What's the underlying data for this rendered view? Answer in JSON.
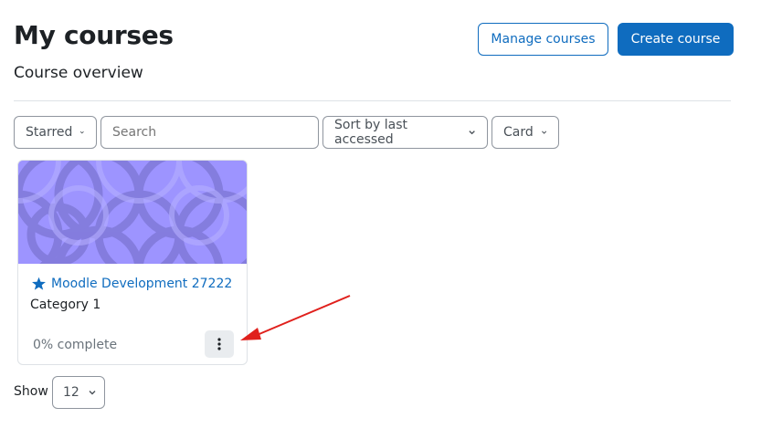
{
  "page": {
    "title": "My courses"
  },
  "header_actions": {
    "manage_courses": "Manage courses",
    "create_course": "Create course"
  },
  "section": {
    "title": "Course overview"
  },
  "filters": {
    "grouping": "Starred",
    "search_placeholder": "Search",
    "sort": "Sort by last accessed",
    "view": "Card"
  },
  "courses": [
    {
      "name": "Moodle Development 27222",
      "category": "Category 1",
      "progress": "0% complete",
      "progress_value": 0,
      "starred": true,
      "star_icon": "star-icon",
      "menu_icon": "kebab-menu-icon"
    }
  ],
  "pagination": {
    "show_label": "Show",
    "per_page": "12"
  },
  "colors": {
    "primary": "#0f6cbf",
    "course_image": "#9d94ff",
    "annotation_arrow": "#e0201c"
  }
}
